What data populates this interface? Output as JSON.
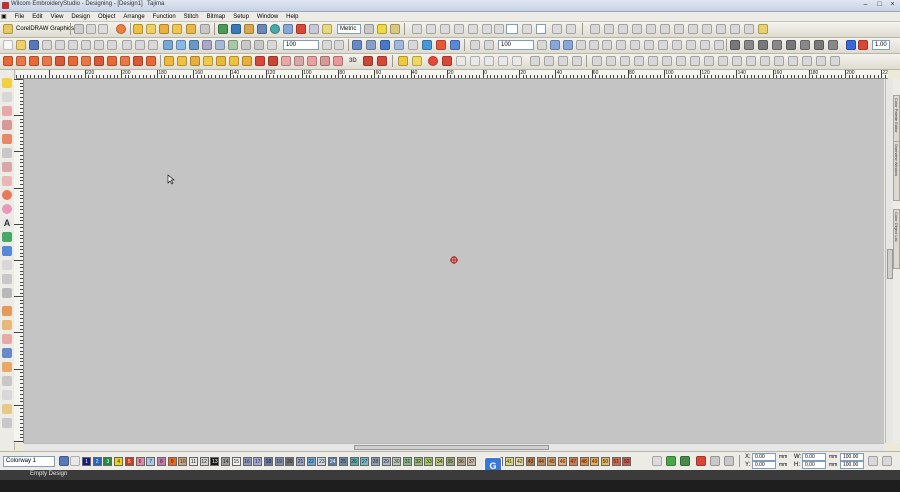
{
  "titlebar": {
    "title": "Wilcom EmbroideryStudio - Designing - [Design1]",
    "machine": "Tajima"
  },
  "menu": [
    "File",
    "Edit",
    "View",
    "Design",
    "Object",
    "Arrange",
    "Function",
    "Stitch",
    "Bitmap",
    "Setup",
    "Window",
    "Help"
  ],
  "toolbar": {
    "corel_label": "CorelDRAW Graphics",
    "units": "Metric",
    "zoom_left": "100",
    "zoom_right": "100",
    "scale": "1.00"
  },
  "ruler": {
    "labels": [
      "220",
      "200",
      "180",
      "160",
      "140",
      "120",
      "100",
      "80",
      "60",
      "40",
      "20",
      "0",
      "20",
      "40",
      "60",
      "80",
      "100",
      "120",
      "140",
      "160",
      "180",
      "200",
      "220"
    ]
  },
  "colorway": {
    "label": "Colorway 1",
    "swatches": [
      {
        "n": "1",
        "c": "#1a1a7a"
      },
      {
        "n": "2",
        "c": "#1f66c8"
      },
      {
        "n": "3",
        "c": "#1e8c3a"
      },
      {
        "n": "4",
        "c": "#e8d21a"
      },
      {
        "n": "5",
        "c": "#d43a1a"
      },
      {
        "n": "6",
        "c": "#e38aa5"
      },
      {
        "n": "7",
        "c": "#a8c8e8"
      },
      {
        "n": "8",
        "c": "#c878b0"
      },
      {
        "n": "9",
        "c": "#e86a1a"
      },
      {
        "n": "10",
        "c": "#c8a878"
      },
      {
        "n": "11",
        "c": "#e6e6e6"
      },
      {
        "n": "12",
        "c": "#cfcfcf"
      },
      {
        "n": "13",
        "c": "#1a1a1a"
      },
      {
        "n": "14",
        "c": "#9a9a9a"
      },
      {
        "n": "15",
        "c": "#f0f0f0"
      },
      {
        "n": "16",
        "c": "#8a9ac8"
      },
      {
        "n": "17",
        "c": "#a0a8d8"
      },
      {
        "n": "18",
        "c": "#6878a8"
      },
      {
        "n": "19",
        "c": "#8090b0"
      },
      {
        "n": "20",
        "c": "#707070"
      },
      {
        "n": "21",
        "c": "#9aa0c8"
      },
      {
        "n": "22",
        "c": "#68a8e0"
      },
      {
        "n": "23",
        "c": "#c8d8e8"
      },
      {
        "n": "24",
        "c": "#5a7aa0"
      },
      {
        "n": "25",
        "c": "#6a88a8"
      },
      {
        "n": "26",
        "c": "#58a8a8"
      },
      {
        "n": "27",
        "c": "#78b8c8"
      },
      {
        "n": "28",
        "c": "#88a0b8"
      },
      {
        "n": "29",
        "c": "#a8b8c8"
      },
      {
        "n": "30",
        "c": "#b8c8b8"
      },
      {
        "n": "31",
        "c": "#88b888"
      },
      {
        "n": "32",
        "c": "#98b878"
      },
      {
        "n": "33",
        "c": "#a8c868"
      },
      {
        "n": "34",
        "c": "#b8c878"
      },
      {
        "n": "35",
        "c": "#98a878"
      },
      {
        "n": "36",
        "c": "#b8a888"
      },
      {
        "n": "37",
        "c": "#c8b8a8"
      },
      {
        "n": "40",
        "c": "#e8e888"
      },
      {
        "n": "41",
        "c": "#d8d878"
      },
      {
        "n": "42",
        "c": "#e8d898"
      },
      {
        "n": "43",
        "c": "#b87848"
      },
      {
        "n": "44",
        "c": "#c88858"
      },
      {
        "n": "45",
        "c": "#d89858"
      },
      {
        "n": "46",
        "c": "#e8a868"
      },
      {
        "n": "47",
        "c": "#d87848"
      },
      {
        "n": "48",
        "c": "#e88838"
      },
      {
        "n": "49",
        "c": "#f0a848"
      },
      {
        "n": "50",
        "c": "#e8b858"
      },
      {
        "n": "51",
        "c": "#d86848"
      },
      {
        "n": "52",
        "c": "#c85848"
      }
    ]
  },
  "coords": {
    "x_label": "X:",
    "x_value": "0.00",
    "y_label": "Y:",
    "y_value": "0.00",
    "w_label": "W:",
    "w_value": "0.00",
    "h_label": "H:",
    "h_value": "0.00",
    "unit": "mm",
    "pct1": "100.00",
    "pct2": "100.00"
  },
  "docker_tabs": [
    "Color Palette Editor",
    "Overview Window",
    "Color Object List"
  ],
  "status": {
    "text": "Empty Design"
  }
}
